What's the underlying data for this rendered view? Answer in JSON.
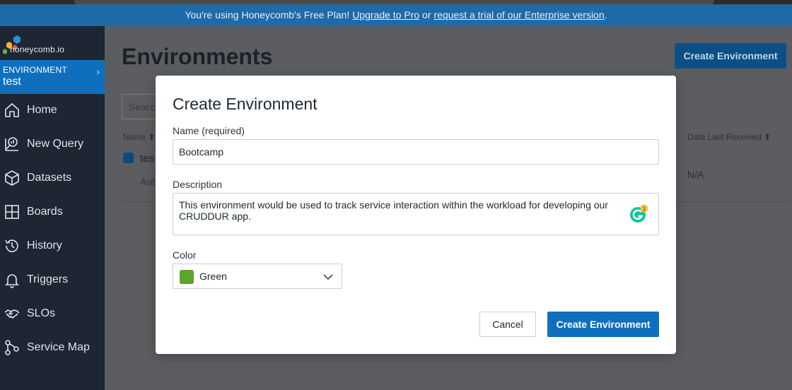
{
  "banner": {
    "text": "You're using Honeycomb's Free Plan! ",
    "link1": "Upgrade to Pro",
    "mid": " or ",
    "link2": "request a trial of our Enterprise version",
    "end": "."
  },
  "sidebar": {
    "logo_text": "honeycomb.io",
    "environment_label": "ENVIRONMENT",
    "environment_name": "test",
    "items": [
      {
        "label": "Home",
        "icon": "home-icon"
      },
      {
        "label": "New Query",
        "icon": "query-icon"
      },
      {
        "label": "Datasets",
        "icon": "cube-icon"
      },
      {
        "label": "Boards",
        "icon": "grid-icon"
      },
      {
        "label": "History",
        "icon": "history-icon"
      },
      {
        "label": "Triggers",
        "icon": "bell-icon"
      },
      {
        "label": "SLOs",
        "icon": "handshake-icon"
      },
      {
        "label": "Service Map",
        "icon": "service-map-icon"
      }
    ]
  },
  "main": {
    "title": "Environments",
    "create_button": "Create Environment",
    "search_placeholder": "Search",
    "columns": {
      "name": "Name",
      "data_last_received": "Data Last Received"
    },
    "row": {
      "name": "tes",
      "subtext": "Aut",
      "data_last_received": "N/A"
    }
  },
  "modal": {
    "title": "Create Environment",
    "name_label": "Name (required)",
    "name_value": "Bootcamp",
    "description_label": "Description",
    "description_value": "This environment would be used to track service interaction within the workload for developing our CRUDDUR app.",
    "grammarly_badge": "1",
    "color_label": "Color",
    "color_value": "Green",
    "color_hex": "#5aa627",
    "cancel_label": "Cancel",
    "create_label": "Create Environment"
  },
  "colors": {
    "banner": "#1f6aa8",
    "sidebar": "#1d2632",
    "env_highlight": "#0f6fbf",
    "primary_button": "#0f6fbf"
  }
}
